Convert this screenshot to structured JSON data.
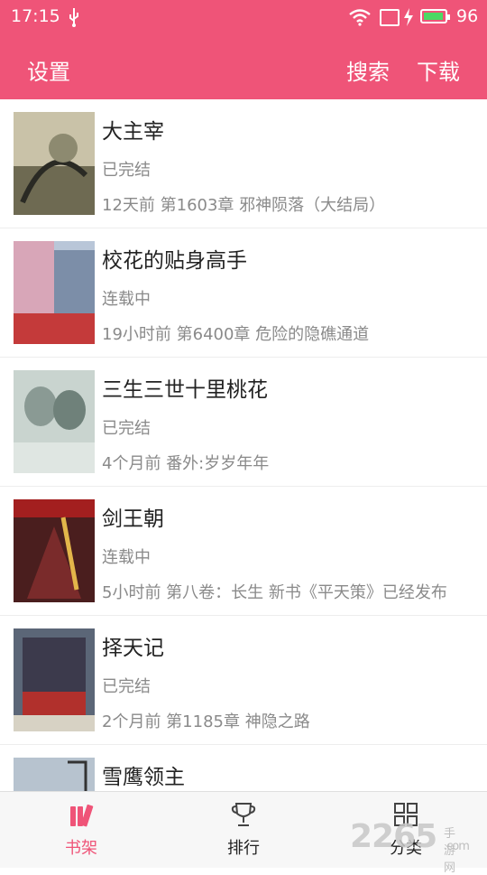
{
  "status_bar": {
    "time": "17:15",
    "battery": "96",
    "battery_level": 0.96
  },
  "app_bar": {
    "settings": "设置",
    "search": "搜索",
    "download": "下载"
  },
  "books": [
    {
      "title": "大主宰",
      "status": "已完结",
      "update": "12天前 第1603章 邪神陨落（大结局）"
    },
    {
      "title": "校花的贴身高手",
      "status": "连载中",
      "update": "19小时前 第6400章 危险的隐礁通道"
    },
    {
      "title": "三生三世十里桃花",
      "status": "已完结",
      "update": "4个月前 番外:岁岁年年"
    },
    {
      "title": "剑王朝",
      "status": "连载中",
      "update": "5小时前 第八卷：长生 新书《平天策》已经发布"
    },
    {
      "title": "择天记",
      "status": "已完结",
      "update": "2个月前 第1185章 神隐之路"
    },
    {
      "title": "雪鹰领主",
      "status": "",
      "update": ""
    }
  ],
  "tabs": [
    {
      "label": "书架",
      "icon": "bookshelf-icon"
    },
    {
      "label": "排行",
      "icon": "trophy-icon"
    },
    {
      "label": "分类",
      "icon": "grid-icon"
    }
  ],
  "colors": {
    "accent": "#ef5478",
    "tab_active": "#ef5478"
  },
  "watermark": {
    "brand": "2265",
    "sub": "手游网",
    "domain": ".com"
  }
}
